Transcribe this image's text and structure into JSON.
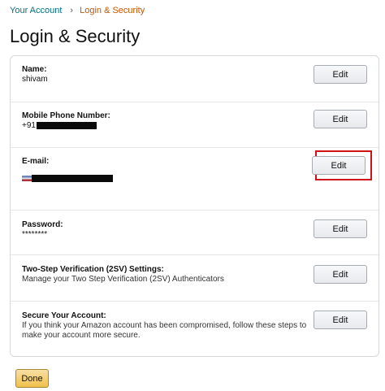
{
  "breadcrumb": {
    "parent": "Your Account",
    "separator": "›",
    "current": "Login & Security"
  },
  "page_title": "Login & Security",
  "rows": [
    {
      "label": "Name:",
      "value": "shivam",
      "button": "Edit"
    },
    {
      "label": "Mobile Phone Number:",
      "value": "+91",
      "button": "Edit"
    },
    {
      "label": "E-mail:",
      "value": "",
      "button": "Edit"
    },
    {
      "label": "Password:",
      "value": "********",
      "button": "Edit"
    },
    {
      "label": "Two-Step Verification (2SV) Settings:",
      "value": "Manage your Two Step Verification (2SV) Authenticators",
      "button": "Edit"
    },
    {
      "label": "Secure Your Account:",
      "value": "If you think your Amazon account has been compromised, follow these steps to make your account more secure.",
      "button": "Edit"
    }
  ],
  "done_button": "Done",
  "colors": {
    "link": "#007185",
    "current_crumb": "#c45500",
    "highlight": "#d0121b",
    "done_bg": "#f0c14b"
  }
}
